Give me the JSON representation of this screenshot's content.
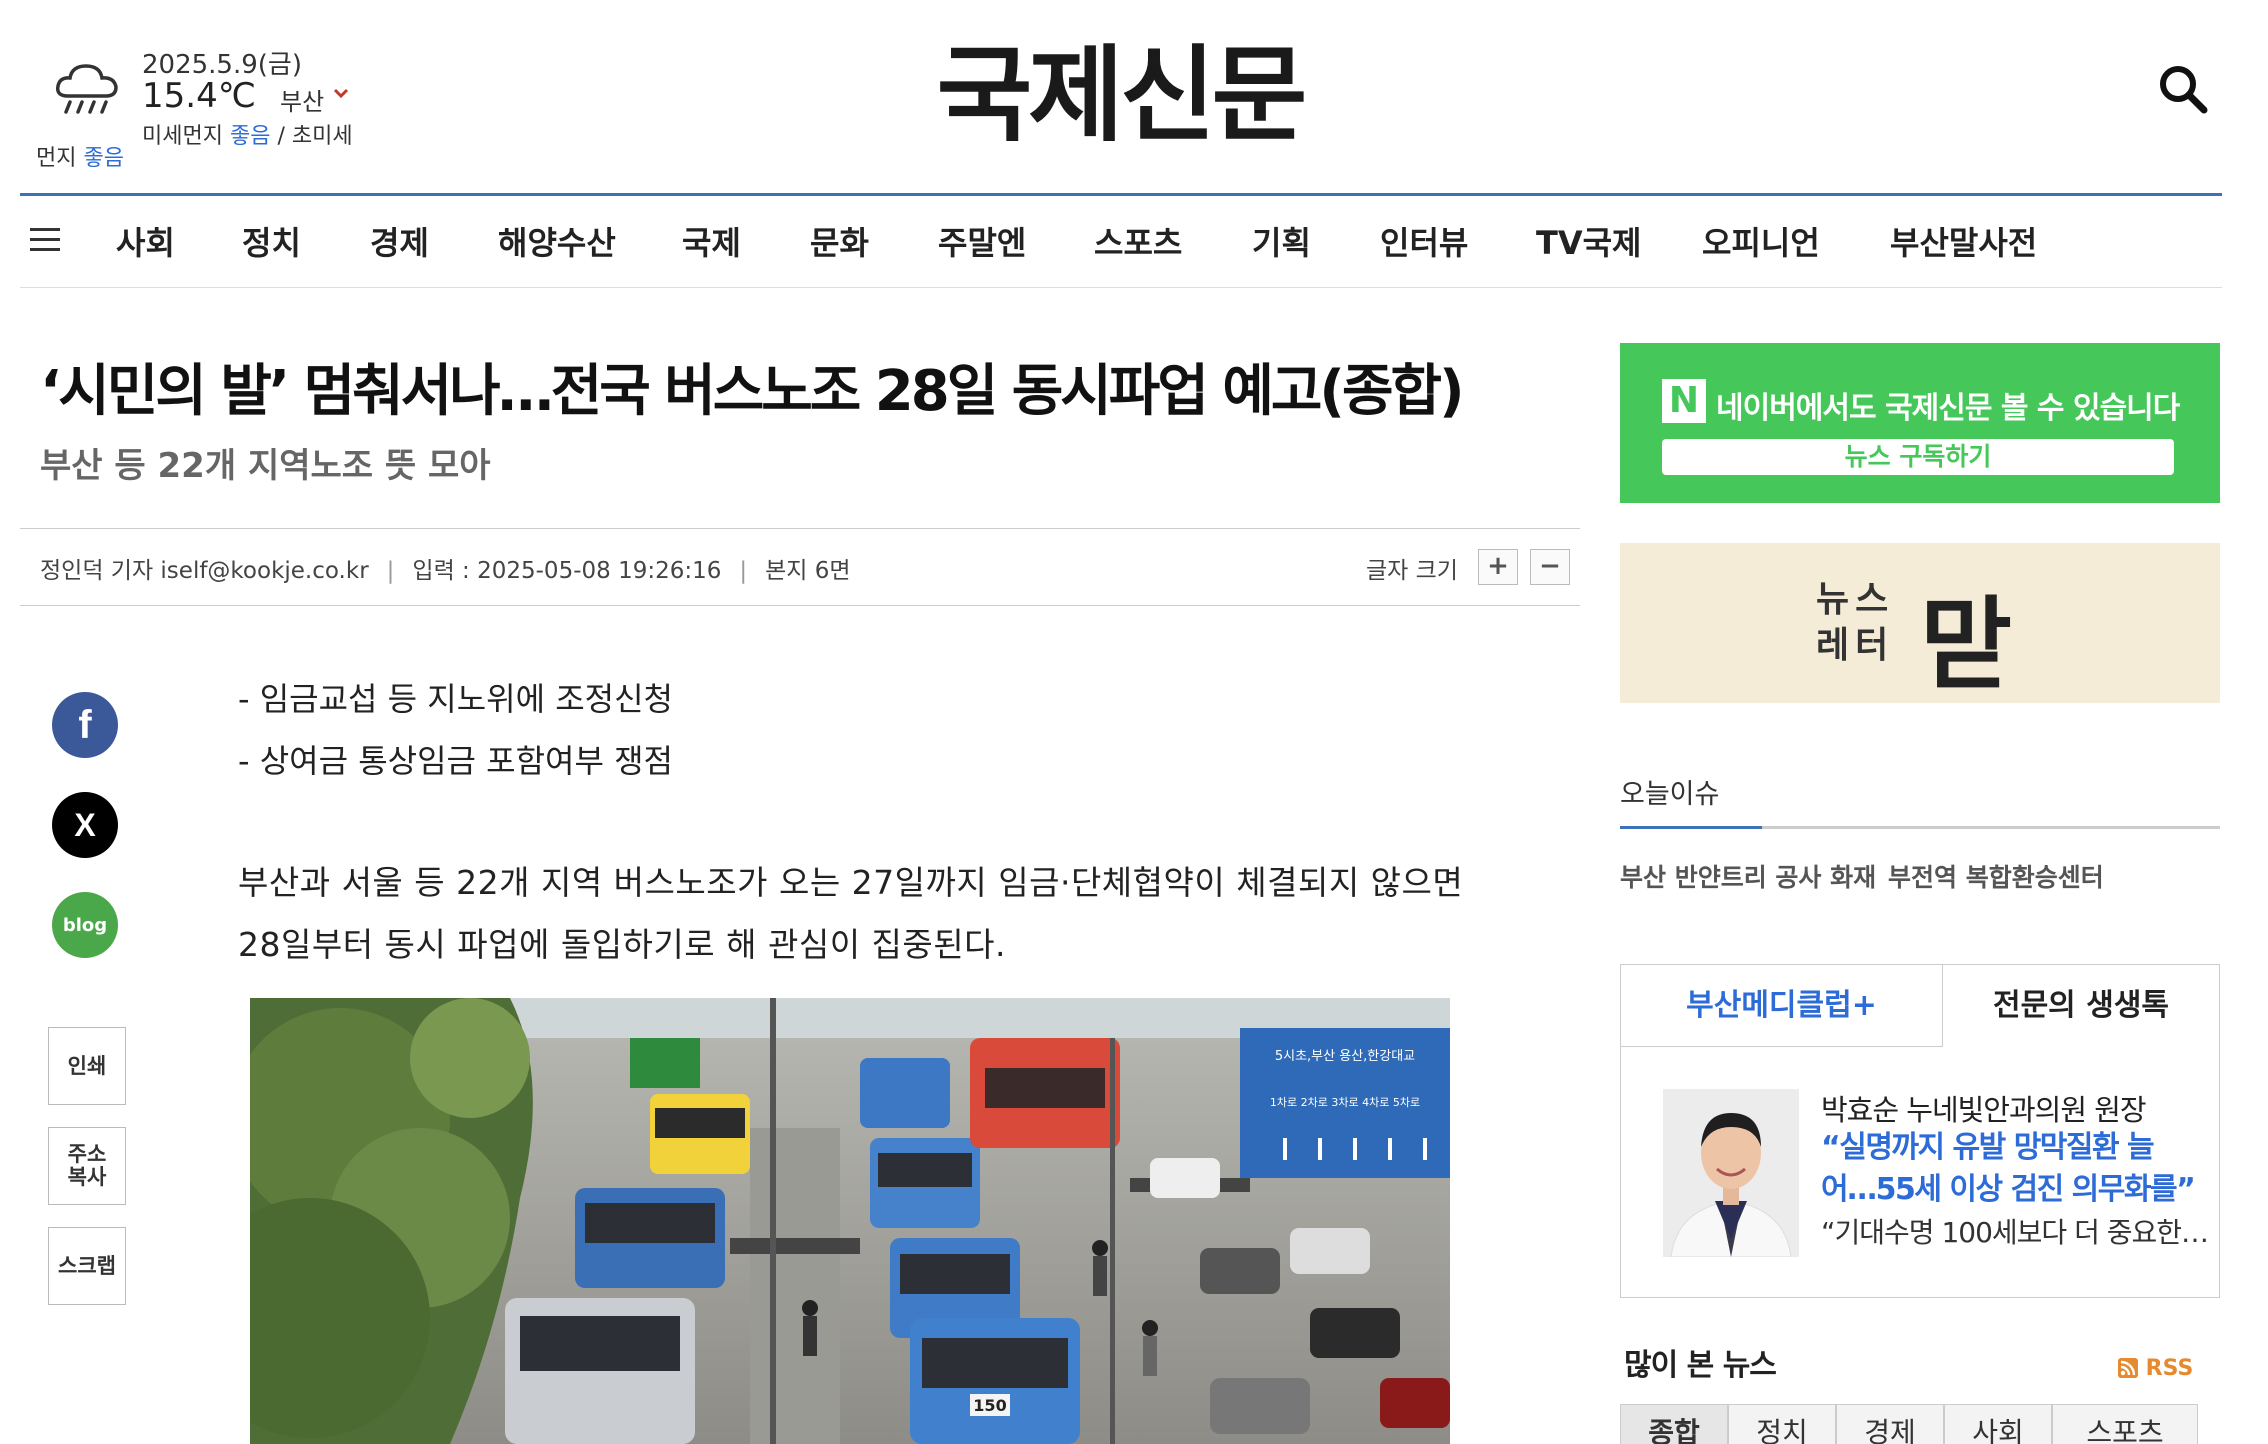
{
  "weather": {
    "date": "2025.5.9(금)",
    "temperature": "15.4℃",
    "city": "부산",
    "fine_dust_label": "미세먼지",
    "fine_dust_value": "좋음",
    "ultra_fine_label": "/ 초미세",
    "dust_label": "먼지",
    "dust_value": "좋음",
    "icon": "rain-cloud-icon"
  },
  "logo": "국제신문",
  "nav": {
    "items": [
      "사회",
      "정치",
      "경제",
      "해양수산",
      "국제",
      "문화",
      "주말엔",
      "스포츠",
      "기획",
      "인터뷰",
      "TV국제",
      "오피니언",
      "부산말사전"
    ]
  },
  "article": {
    "headline": "‘시민의 발’ 멈춰서나…전국 버스노조 28일 동시파업 예고(종합)",
    "subhead": "부산 등 22개 지역노조 뜻 모아",
    "reporter": "정인덕 기자 iself@kookje.co.kr",
    "published": "입력 : 2025-05-08 19:26:16",
    "page": "본지 6면",
    "font_size_label": "글자 크기",
    "font_plus": "+",
    "font_minus": "−",
    "summary": [
      "- 임금교섭 등 지노위에 조정신청",
      "- 상여금 통상임금 포함여부 쟁점"
    ],
    "body": "부산과 서울 등 22개 지역 버스노조가 오는 27일까지 임금·단체협약이 체결되지 않으면 28일부터 동시 파업에 돌입하기로 해 관심이 집중된다.",
    "photo_sign_text": "5시초,부산 용산,한강대교",
    "photo_sign_lanes": "1차로 2차로 3차로 4차로 5차로",
    "bus_number": "150"
  },
  "share": {
    "facebook": "f",
    "x": "X",
    "blog": "blog",
    "print": "인쇄",
    "copy_url": "주소\n복사",
    "scrap": "스크랩"
  },
  "sidebar": {
    "naver": {
      "badge": "N",
      "text": "네이버에서도 국제신문 볼 수 있습니다",
      "button": "뉴스 구독하기"
    },
    "newsletter": {
      "small_line1": "뉴스",
      "small_line2": "레터",
      "big": "맏"
    },
    "issue": {
      "title": "오늘이슈",
      "tags": [
        "부산 반얀트리 공사 화재",
        "부전역 복합환승센터"
      ]
    },
    "clinic": {
      "tabs": [
        "부산메디클럽+",
        "전문의 생생톡"
      ],
      "doctor": "박효순 누네빛안과의원 원장",
      "quote": "“실명까지 유발 망막질환 늘어…55세 이상 검진 의무화를”",
      "sub": "“기대수명 100세보다 더 중요한…"
    },
    "popular": {
      "title": "많이 본 뉴스",
      "rss": "RSS",
      "tabs": [
        "종합",
        "정치",
        "경제",
        "사회",
        "스포츠"
      ]
    }
  },
  "colors": {
    "accent": "#3c73b8",
    "naver_green": "#45c75a",
    "link_blue": "#2d6bd6",
    "newsletter_bg": "#f4ecd7",
    "facebook": "#3b5998"
  }
}
